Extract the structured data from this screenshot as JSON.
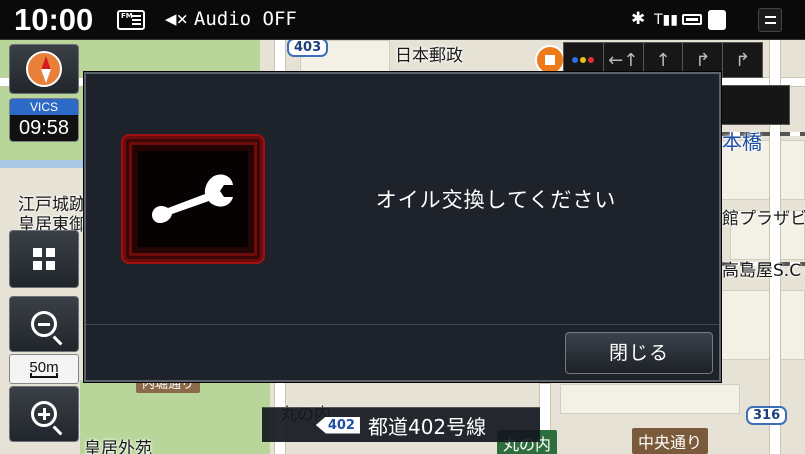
{
  "status_bar": {
    "time": "10:00",
    "radio_icon_text": "FM",
    "audio_status": "Audio OFF",
    "icons": [
      "radio-icon",
      "mute-icon",
      "bluetooth-icon",
      "signal-icon",
      "battery-icon",
      "phone-icon",
      "menu-icon"
    ]
  },
  "map": {
    "labels": {
      "nihon_yusei": "日本郵政",
      "edojo": "江戸城跡",
      "kokyo_higashi": "皇居東御苑",
      "kokyo_gaien": "皇居外苑",
      "marunouchi": "丸の内",
      "nihonbashi": "本橋",
      "takashimaya": "高島屋S.C",
      "tokyu_plaza": "館プラザビ",
      "marunouchi_station": "丸の内"
    },
    "street_labels": {
      "chuo_dori": "中央通り",
      "uchibori": "内堀通り"
    },
    "route_numbers": {
      "r403": "403",
      "r316": "316"
    }
  },
  "side_controls": {
    "vics_label": "VICS",
    "vics_time": "09:58",
    "scale": "50m"
  },
  "lane_guide": {
    "lanes": [
      "dots",
      "←↑",
      "↑",
      "↱",
      "↱"
    ]
  },
  "dialog": {
    "message": "オイル交換してください",
    "close_label": "閉じる",
    "icon": "wrench-icon"
  },
  "current_road": {
    "route_number": "402",
    "name": "都道402号線"
  },
  "colors": {
    "accent_orange": "#ef7a1a",
    "vics_blue": "#2d69c6",
    "dialog_bg": "#1e222a",
    "icon_frame_red": "#a01010"
  }
}
